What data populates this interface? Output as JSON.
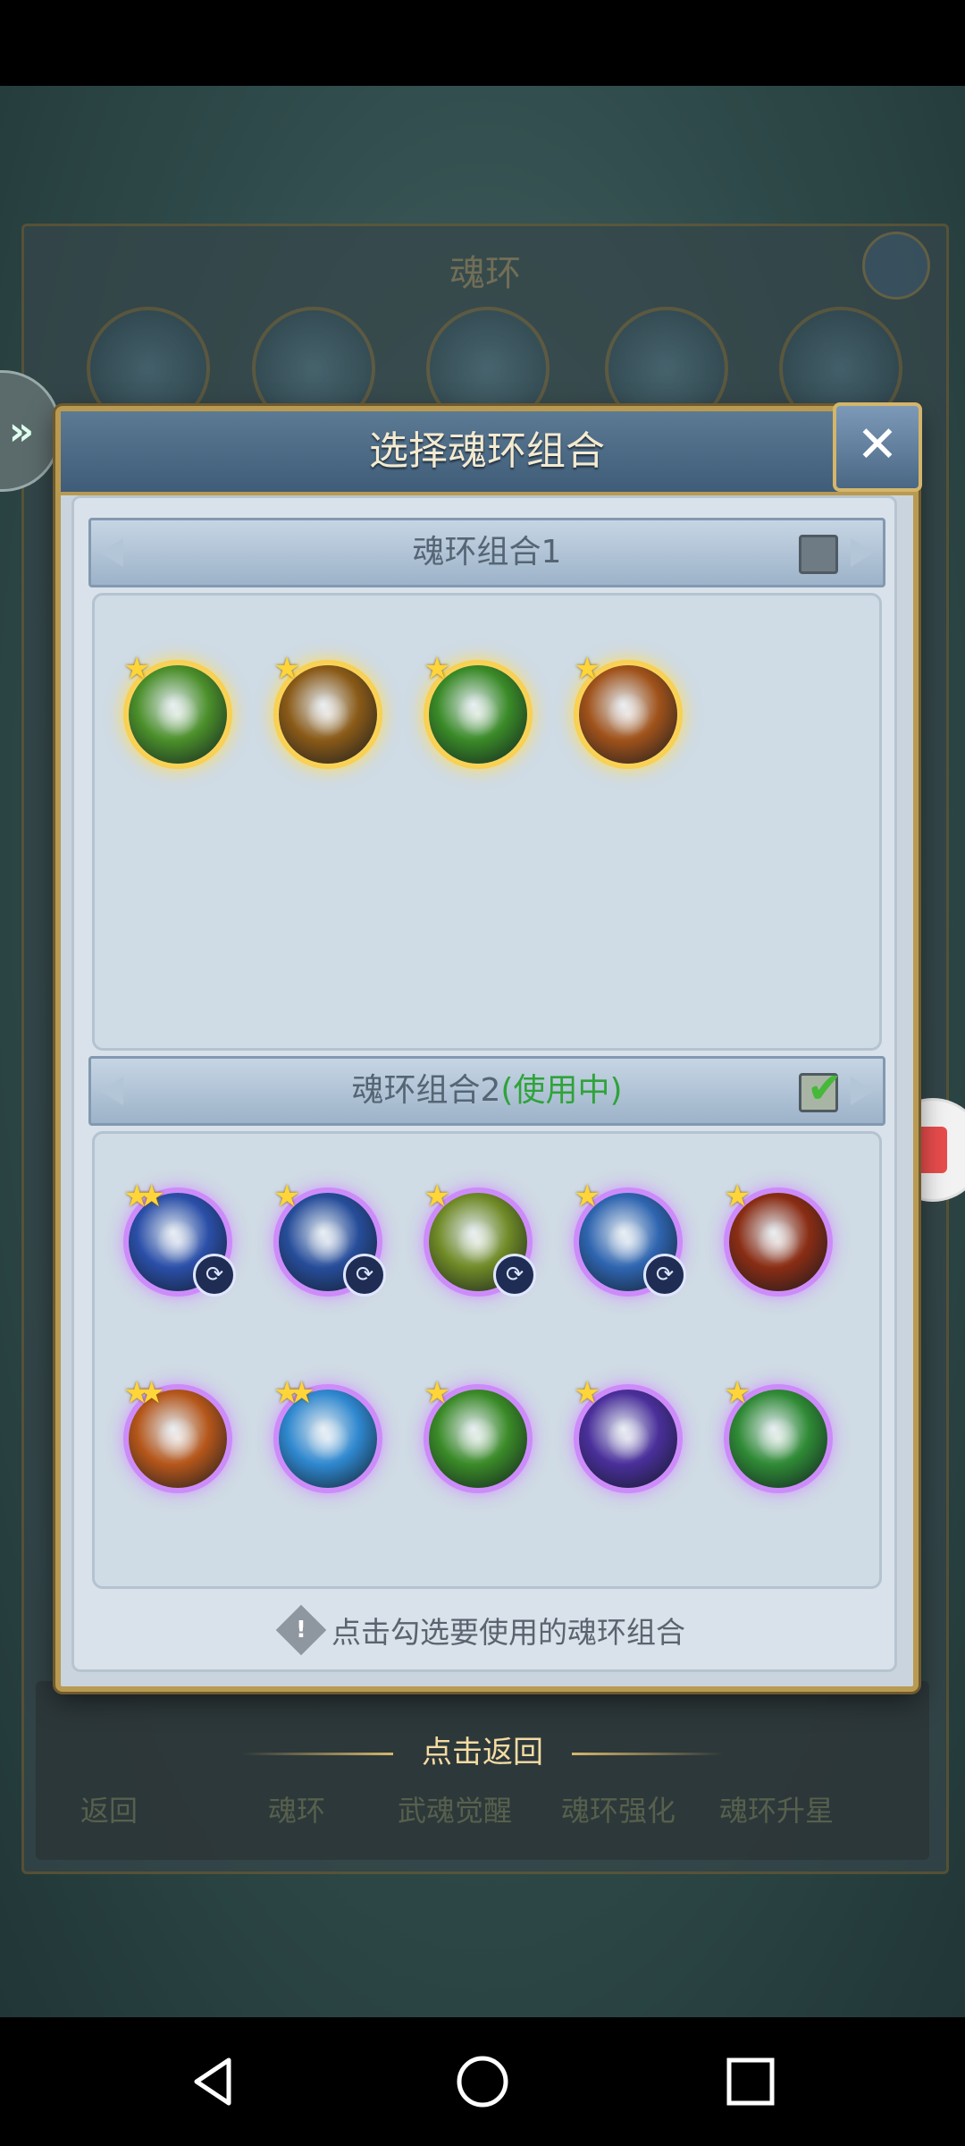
{
  "background": {
    "title": "魂环",
    "bottom_items": [
      "返回",
      "魂环",
      "武魂觉醒",
      "魂环强化",
      "魂环升星"
    ]
  },
  "dialog": {
    "title": "选择魂环组合",
    "close_icon": "close-x",
    "group1": {
      "label": "魂环组合1",
      "checked": false,
      "rings": [
        {
          "stars": 1,
          "color": "#4b8f2a",
          "icon": "clover-ring"
        },
        {
          "stars": 1,
          "color": "#8a5a17",
          "icon": "golden-face-ring"
        },
        {
          "stars": 1,
          "color": "#3a8a27",
          "icon": "sprout-ring"
        },
        {
          "stars": 1,
          "color": "#a0521a",
          "icon": "spiral-shield-ring"
        }
      ]
    },
    "group2": {
      "label": "魂环组合2",
      "status": "(使用中)",
      "checked": true,
      "rings": [
        {
          "stars": 2,
          "color": "#2b4fa8",
          "icon": "blue-figure-ring",
          "badge": "swap-icon"
        },
        {
          "stars": 1,
          "color": "#274d9a",
          "icon": "ice-spear-ring",
          "badge": "swap-icon"
        },
        {
          "stars": 1,
          "color": "#6f8a26",
          "icon": "green-bubbles-ring",
          "badge": "swap-icon"
        },
        {
          "stars": 1,
          "color": "#2f65b0",
          "icon": "water-swirl-ring",
          "badge": "swap-icon"
        },
        {
          "stars": 1,
          "color": "#8a2d14",
          "icon": "fire-emblem-ring"
        },
        {
          "stars": 2,
          "color": "#b5561a",
          "icon": "spiral-shield-ring"
        },
        {
          "stars": 2,
          "color": "#2f88cf",
          "icon": "lightning-ring"
        },
        {
          "stars": 1,
          "color": "#3a8a27",
          "icon": "sprout-ring"
        },
        {
          "stars": 1,
          "color": "#4a2f9a",
          "icon": "void-orb-ring"
        },
        {
          "stars": 1,
          "color": "#2f8a35",
          "icon": "green-burst-ring"
        }
      ]
    },
    "hint": "点击勾选要使用的魂环组合"
  },
  "back_text": "点击返回",
  "nav": {
    "back_icon": "triangle-back",
    "home_icon": "circle-home",
    "recent_icon": "square-recent"
  }
}
